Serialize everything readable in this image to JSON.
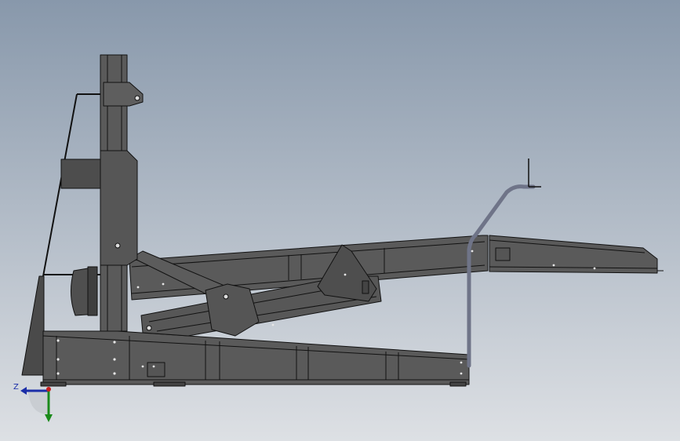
{
  "viewport": {
    "background_top": "#8898ab",
    "background_bottom": "#dde0e4",
    "part_fill": "#5c5c5c",
    "part_fill_dark": "#3f3f3f",
    "edge_color": "#111111",
    "rail_color": "#6f7488"
  },
  "triad": {
    "z_label": "Z",
    "x_color": "#1b2ea8",
    "y_color": "#1a8a1a",
    "z_color": "#c81e1e"
  }
}
